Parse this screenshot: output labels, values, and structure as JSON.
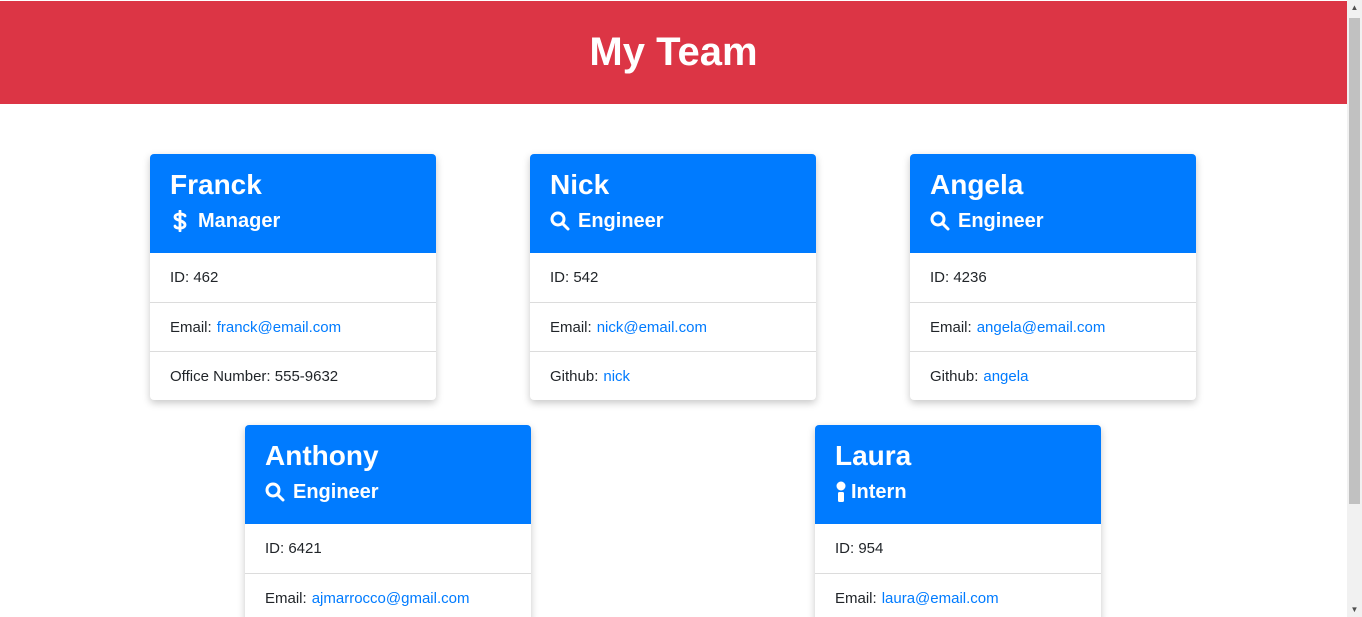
{
  "page": {
    "title": "My Team"
  },
  "colors": {
    "header_bg": "#dc3545",
    "card_header_bg": "#007bff",
    "link": "#007bff"
  },
  "cards": [
    {
      "name": "Franck",
      "role": "Manager",
      "icon": "dollar-icon",
      "id_label": "ID: 462",
      "email_label": "Email:",
      "email": "franck@email.com",
      "extra_label": "Office Number: 555-9632",
      "extra_link": ""
    },
    {
      "name": "Nick",
      "role": "Engineer",
      "icon": "search-icon",
      "id_label": "ID: 542",
      "email_label": "Email:",
      "email": "nick@email.com",
      "extra_label": "Github:",
      "extra_link": "nick"
    },
    {
      "name": "Angela",
      "role": "Engineer",
      "icon": "search-icon",
      "id_label": "ID: 4236",
      "email_label": "Email:",
      "email": "angela@email.com",
      "extra_label": "Github:",
      "extra_link": "angela"
    },
    {
      "name": "Anthony",
      "role": "Engineer",
      "icon": "search-icon",
      "id_label": "ID: 6421",
      "email_label": "Email:",
      "email": "ajmarrocco@gmail.com"
    },
    {
      "name": "Laura",
      "role": "Intern",
      "icon": "graduate-icon",
      "id_label": "ID: 954",
      "email_label": "Email:",
      "email": "laura@email.com"
    }
  ]
}
